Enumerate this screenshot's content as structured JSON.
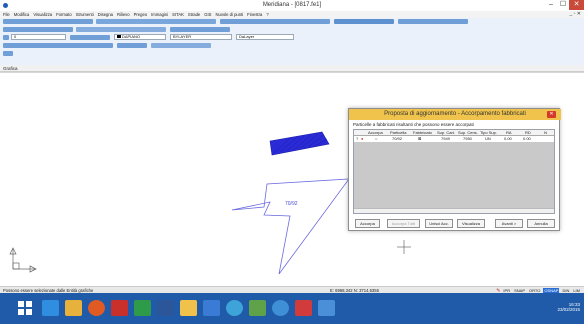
{
  "window": {
    "title": "Meridiana - [0817.fe1]",
    "minimize": "–",
    "maximize": "☐",
    "close": "✕"
  },
  "menu": [
    "File",
    "Modifica",
    "Visualizza",
    "Formato",
    "Strumenti",
    "Disegna",
    "Rilievo",
    "Pregeo",
    "Immagini",
    "SITAK",
    "Strade",
    "GIS",
    "Nuvole di punti",
    "Finestra",
    "?"
  ],
  "mdi_controls": "_ ▫ ✕",
  "toolbar": {
    "layer_value": "0",
    "color_value": "DAPIANO",
    "linetype_value": "BYLAYER",
    "lineweight_value": "DaLayer"
  },
  "panel_tab": "Grafica",
  "drawing": {
    "parcel_label": "70/92",
    "colors": {
      "highlight": "#2a2ad6",
      "outline": "#6a6ae0"
    }
  },
  "dialog": {
    "title": "Proposta di aggiornamento - Accorpamento fabbricati",
    "close_icon": "close-icon",
    "description": "Particelle a fabbricati risultanti che possono essere accorpati",
    "columns": [
      "Accorpa",
      "Particella",
      "Fabbricato",
      "Sup. Cart.",
      "Sup. Cens.",
      "Tipo Sup.",
      "RA",
      "RD",
      "N"
    ],
    "rows": [
      {
        "marker": "?",
        "accorpa": "○",
        "particella": "70/92",
        "fabbricato": "⊠",
        "sup_cart": "7949",
        "sup_cens": "7950",
        "tipo_sup": "UN",
        "ra": "0.00",
        "rd": "0.00",
        "n": ""
      }
    ],
    "buttons": {
      "accorpa": "Accorpa",
      "accorpa_tutti": "Accorpa Tutti",
      "unisci_acc": "Unisci Acc.",
      "visualizza": "Visualizza",
      "avanti": "Avanti >",
      "annulla": "Annulla"
    }
  },
  "status": {
    "message": "Possono essere selezionate dalle Entità grafiche",
    "coords": "E: 6968,342  N: 3714,6355",
    "buttons": [
      "IPR",
      "SNAP",
      "ORTO",
      "OSNAP",
      "DIN",
      "LIM"
    ],
    "active_button": "OSNAP"
  },
  "taskbar": {
    "time": "16:33",
    "date": "23/02/2015",
    "icons": [
      "start-icon",
      "ie-icon",
      "explorer-icon",
      "media-icon",
      "app-icon-red",
      "app-icon-green",
      "word-icon",
      "folder-icon",
      "app-icon-blue",
      "app-icon-globe",
      "app-icon-map",
      "app-icon-chrome",
      "app-icon-red2",
      "app-icon-square"
    ],
    "colors": {
      "bar": "#1f5ba8"
    }
  }
}
